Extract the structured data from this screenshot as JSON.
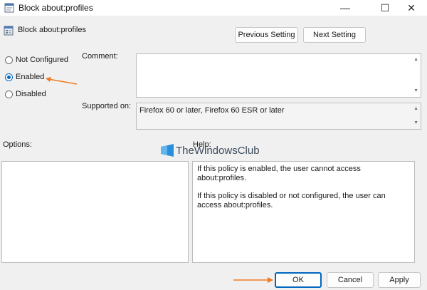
{
  "window": {
    "title": "Block about:profiles",
    "min_glyph": "—",
    "max_glyph": "☐",
    "close_glyph": "✕"
  },
  "policy": {
    "title": "Block about:profiles"
  },
  "nav": {
    "previous_label": "Previous Setting",
    "next_label": "Next Setting"
  },
  "state": {
    "options": [
      {
        "label": "Not Configured",
        "selected": false
      },
      {
        "label": "Enabled",
        "selected": true
      },
      {
        "label": "Disabled",
        "selected": false
      }
    ]
  },
  "comment": {
    "label": "Comment:",
    "value": ""
  },
  "supported": {
    "label": "Supported on:",
    "value": "Firefox 60 or later, Firefox 60 ESR or later"
  },
  "options_panel": {
    "label": "Options:"
  },
  "help_panel": {
    "label": "Help:",
    "paragraphs": [
      "If this policy is enabled, the user cannot access about:profiles.",
      "If this policy is disabled or not configured, the user can access about:profiles."
    ]
  },
  "watermark": {
    "text": "TheWindowsClub"
  },
  "footer": {
    "ok_label": "OK",
    "cancel_label": "Cancel",
    "apply_label": "Apply"
  },
  "colors": {
    "accent": "#0067c0",
    "annotation_arrow": "#f07a22"
  },
  "icons": {
    "app": "policy-document-icon",
    "arrow_up": "▲",
    "arrow_down": "▼"
  }
}
